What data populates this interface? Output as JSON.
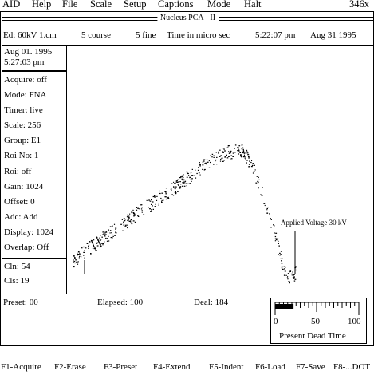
{
  "menubar": {
    "items": [
      "AID",
      "Help",
      "File",
      "Scale",
      "Setup",
      "Captions",
      "Mode",
      "Halt"
    ],
    "counter": "346x"
  },
  "window": {
    "title": "Nucleus PCA - II"
  },
  "infobar": {
    "ed": "Ed: 60kV  1.cm",
    "course": "5 course",
    "fine": "5 fine",
    "time_unit": "Time in micro sec",
    "time": "5:22:07 pm",
    "date": "Aug 31 1995"
  },
  "leftpanel": {
    "start_date": "Aug 01. 1995",
    "start_time": "5:27:03 pm",
    "params": [
      "Acquire: off",
      "Mode: FNA",
      "Timer: live",
      "Scale: 256",
      "Group: E1",
      "Roi No: 1",
      "Roi: off",
      "Gain: 1024",
      "Offset: 0",
      "Adc: Add",
      "Display: 1024",
      "Overlap: Off"
    ],
    "cln": "Cln: 54",
    "cls": "Cls: 19"
  },
  "plot": {
    "annotation": "Applied Voltage 30 kV",
    "color": "#000000"
  },
  "bottombar": {
    "preset": "Preset: 00",
    "elapsed": "Elapsed: 100",
    "deal": "Deal: 184"
  },
  "dead_time": {
    "label": "Present Dead Time",
    "ticks": [
      "0",
      "50",
      "100"
    ],
    "value_percent": 22
  },
  "fkeys": [
    "F1-Acquire",
    "F2-Erase",
    "F3-Preset",
    "F4-Extend",
    "F5-Indent",
    "F6-Load",
    "F7-Save",
    "F8-...DOT"
  ]
}
